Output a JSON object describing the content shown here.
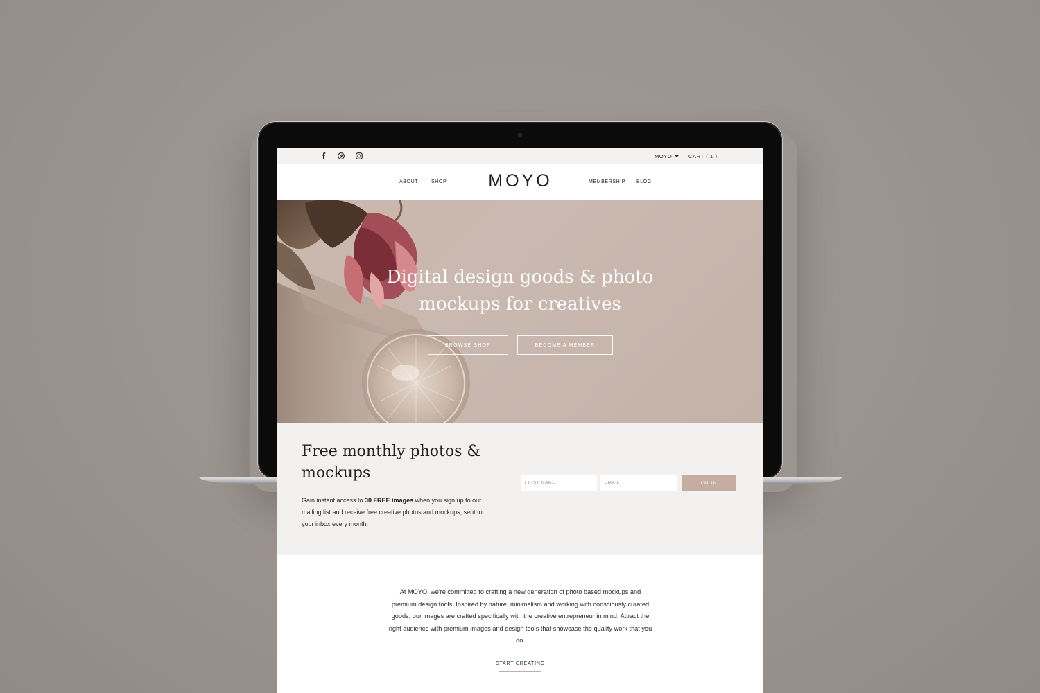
{
  "topbar": {
    "social": [
      "facebook-icon",
      "pinterest-icon",
      "instagram-icon"
    ],
    "account_label": "MOYO",
    "cart_label": "CART ( 1 )"
  },
  "nav": {
    "left": [
      "ABOUT",
      "SHOP"
    ],
    "logo": "MOYO",
    "right": [
      "MEMBERSHIP",
      "BLOG"
    ]
  },
  "hero": {
    "title": "Digital design goods & photo\nmockups for creatives",
    "buttons": [
      "BROWSE SHOP",
      "BECOME A MEMBER"
    ]
  },
  "newsletter": {
    "title": "Free monthly photos &\nmockups",
    "body_before": "Gain instant access to ",
    "body_bold": "30 FREE images",
    "body_after": " when you sign up to our mailing list and receive free creative photos and mockups, sent to your inbox every month.",
    "first_name_placeholder": "FIRST NAME",
    "email_placeholder": "EMAIL",
    "submit_label": "I'M IN"
  },
  "about": {
    "text": "At MOYO, we're committed to crafting a new generation of photo based mockups and premium design tools. Inspired by nature, minimalism and working with consciously curated goods, our images are crafted specifically with the creative entrepreneur in mind. Attract the right audience with premium images and design tools that showcase the quality work that you do.",
    "cta": "START CREATING"
  },
  "colors": {
    "background": "#9b938d",
    "accent": "#c5ada2",
    "hero_bg": "#c9b7ad",
    "panel_bg": "#f2f1ef"
  }
}
